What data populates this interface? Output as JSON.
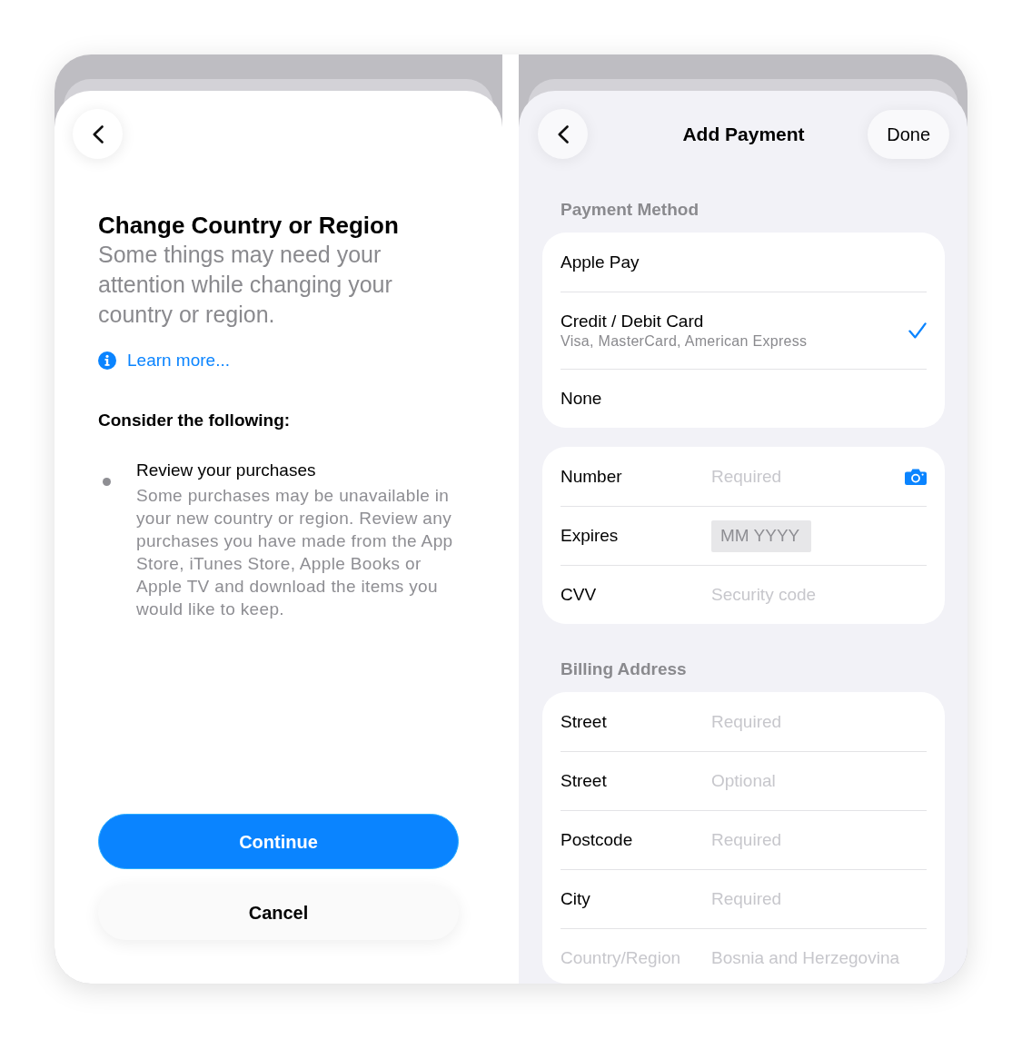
{
  "left_screen": {
    "title": "Change Country or Region",
    "subtitle": "Some things may need your attention while changing your country or region.",
    "learn_more_link": "Learn more...",
    "section_heading": "Consider the following:",
    "items": [
      {
        "title": "Review your purchases",
        "description": "Some purchases may be unavailable in your new country or region. Review any purchases you have made from the App Store, iTunes Store, Apple Books or Apple TV and download the items you would like to keep."
      }
    ],
    "buttons": [
      {
        "label": "Continue",
        "kind": "primary"
      },
      {
        "label": "Cancel",
        "kind": "secondary"
      }
    ]
  },
  "right_screen": {
    "title": "Add Payment",
    "done_button": "Done",
    "payment_method": {
      "heading": "Payment Method",
      "options": [
        {
          "label": "Apple Pay",
          "selected": false
        },
        {
          "label": "Credit / Debit Card",
          "subtitle": "Visa, MasterCard, American Express",
          "selected": true
        },
        {
          "label": "None",
          "selected": false
        }
      ]
    },
    "card_fields": [
      {
        "kind": "scan",
        "label": "Number",
        "placeholder": "Required"
      },
      {
        "kind": "date",
        "label": "Expires",
        "placeholder": "MM YYYY"
      },
      {
        "kind": "text",
        "label": "CVV",
        "placeholder": "Security code"
      }
    ],
    "billing_address": {
      "heading": "Billing Address",
      "fields": [
        {
          "label": "Street",
          "placeholder": "Required",
          "disabled": false
        },
        {
          "label": "Street",
          "placeholder": "Optional",
          "disabled": false
        },
        {
          "label": "Postcode",
          "placeholder": "Required",
          "disabled": false
        },
        {
          "label": "City",
          "placeholder": "Required",
          "disabled": false
        },
        {
          "label": "Country/Region",
          "value": "Bosnia and Herzegovina",
          "disabled": true
        }
      ]
    }
  }
}
